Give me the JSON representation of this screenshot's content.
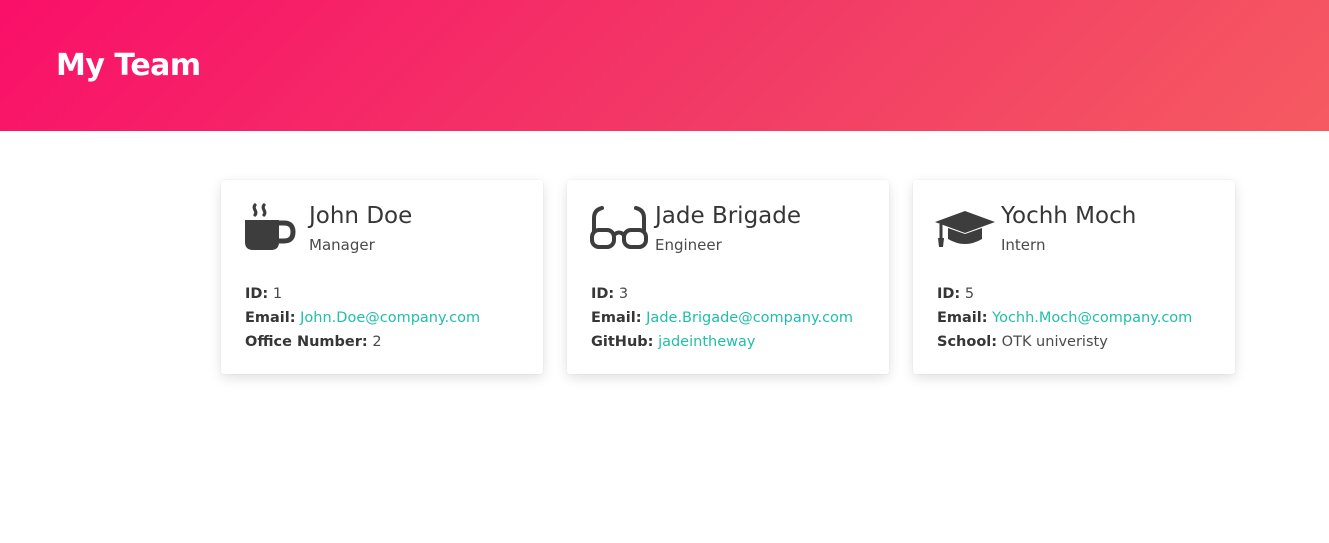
{
  "header": {
    "title": "My Team",
    "gradient_start": "#fa0f69",
    "gradient_end": "#f65a61"
  },
  "colors": {
    "link": "#1fbfa8",
    "icon": "#3d3d3d",
    "text": "#4a4a4a"
  },
  "team": [
    {
      "icon": "coffee-icon",
      "name": "John Doe",
      "role": "Manager",
      "id_label": "ID:",
      "id": "1",
      "email_label": "Email:",
      "email": "John.Doe@company.com",
      "extra_label": "Office Number:",
      "extra": "2"
    },
    {
      "icon": "glasses-icon",
      "name": "Jade Brigade",
      "role": "Engineer",
      "id_label": "ID:",
      "id": "3",
      "email_label": "Email:",
      "email": "Jade.Brigade@company.com",
      "extra_label": "GitHub:",
      "extra": "jadeintheway"
    },
    {
      "icon": "graduation-cap-icon",
      "name": "Yochh Moch",
      "role": "Intern",
      "id_label": "ID:",
      "id": "5",
      "email_label": "Email:",
      "email": "Yochh.Moch@company.com",
      "extra_label": "School:",
      "extra": "OTK univeristy"
    }
  ]
}
